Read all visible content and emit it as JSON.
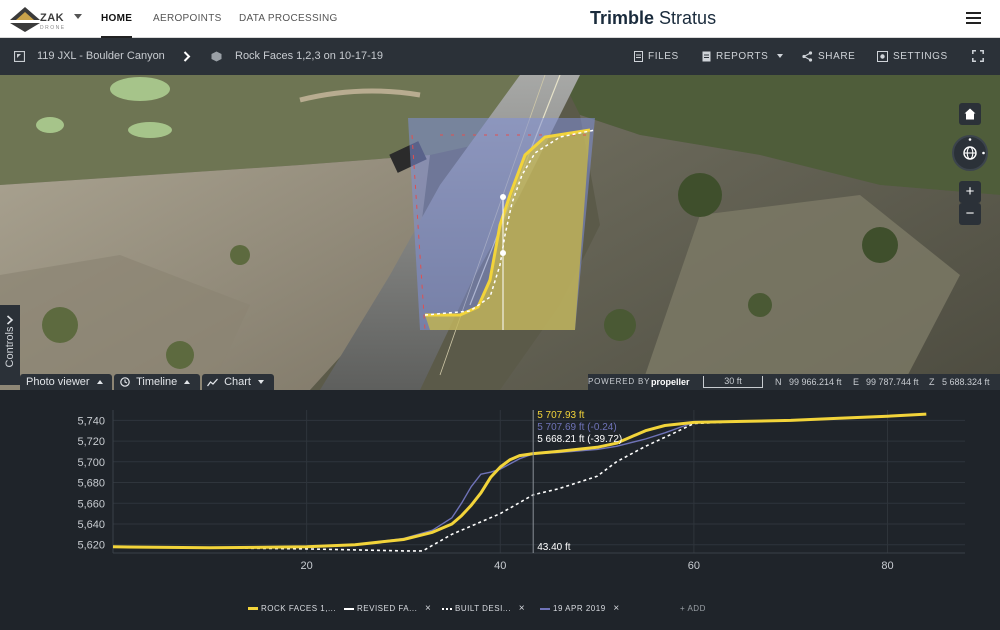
{
  "nav": {
    "logo_text": "ZAK",
    "logo_sub": "DRONE",
    "tabs": [
      "HOME",
      "AEROPOINTS",
      "DATA PROCESSING"
    ],
    "active_tab": "HOME",
    "brand_bold": "Trimble",
    "brand_light": "Stratus"
  },
  "project": {
    "site": "119 JXL - Boulder Canyon",
    "survey": "Rock Faces 1,2,3 on 10-17-19",
    "buttons": {
      "files": "FILES",
      "reports": "REPORTS",
      "share": "SHARE",
      "settings": "SETTINGS"
    }
  },
  "viewport": {
    "home_icon": "home-icon",
    "globe_icon": "globe-icon",
    "zoom_in": "+",
    "zoom_out": "−",
    "controls_label": "Controls",
    "tabs": {
      "photo": "Photo viewer",
      "timeline": "Timeline",
      "chart": "Chart"
    },
    "powered_by": "POWERED BY",
    "powered_brand": "propeller",
    "scale": "30 ft",
    "coords": {
      "n_label": "N",
      "n_value": "99 966.214 ft",
      "e_label": "E",
      "e_value": "99 787.744 ft",
      "z_label": "Z",
      "z_value": "5 688.324 ft"
    }
  },
  "chart_data": {
    "type": "line",
    "title": "",
    "xlabel": "",
    "ylabel": "",
    "xlim": [
      0,
      88
    ],
    "ylim": [
      5612,
      5750
    ],
    "x_ticks": [
      20,
      40,
      60,
      80
    ],
    "y_ticks": [
      5620,
      5640,
      5660,
      5680,
      5700,
      5720,
      5740
    ],
    "y_tick_labels": [
      "5,620",
      "5,640",
      "5,660",
      "5,680",
      "5,700",
      "5,720",
      "5,740"
    ],
    "grid": true,
    "cursor": {
      "x": 43.4,
      "x_label": "43.40 ft",
      "readouts": [
        "5 707.93 ft",
        "5 707.69 ft (-0.24)",
        "5 668.21 ft (-39.72)"
      ]
    },
    "series": [
      {
        "name": "ROCK FACES 1,...",
        "color": "#f2d43a",
        "style": "solid",
        "x": [
          0,
          10,
          20,
          25,
          30,
          33,
          35,
          36,
          37,
          38,
          39,
          40,
          41,
          42,
          43.4,
          46,
          50,
          52,
          55,
          57,
          60,
          65,
          70,
          75,
          80,
          84
        ],
        "y": [
          5618,
          5617,
          5618,
          5620,
          5625,
          5632,
          5640,
          5648,
          5658,
          5670,
          5685,
          5695,
          5702,
          5706,
          5707.9,
          5710,
          5714,
          5718,
          5730,
          5735,
          5738,
          5739,
          5740,
          5742,
          5744,
          5746
        ]
      },
      {
        "name": "REVISED FA...",
        "color": "#ffffff",
        "style": "dashed",
        "x": [
          0,
          10,
          20,
          25,
          30,
          32,
          35,
          38,
          40,
          43.4,
          46,
          50,
          52,
          55,
          58,
          60,
          65,
          70,
          75,
          80,
          84
        ],
        "y": [
          5618,
          5617,
          5616,
          5615,
          5614,
          5614,
          5630,
          5642,
          5650,
          5668.2,
          5674,
          5686,
          5700,
          5715,
          5728,
          5737,
          5739,
          5740,
          5742,
          5744,
          5746
        ]
      },
      {
        "name": "BUILT DESI...",
        "color": "#ffffff",
        "style": "dotted",
        "x": [],
        "y": []
      },
      {
        "name": "19 APR 2019",
        "color": "#6f73b8",
        "style": "solid",
        "x": [
          0,
          10,
          20,
          25,
          30,
          33,
          35,
          36,
          37,
          38,
          39,
          40,
          42,
          43.4,
          46,
          50,
          52,
          55,
          57,
          60
        ],
        "y": [
          5618,
          5617,
          5618,
          5620,
          5626,
          5634,
          5646,
          5660,
          5676,
          5688,
          5690,
          5693,
          5703,
          5707.7,
          5709,
          5712,
          5715,
          5722,
          5728,
          5738
        ]
      }
    ],
    "add_label": "+ ADD"
  }
}
